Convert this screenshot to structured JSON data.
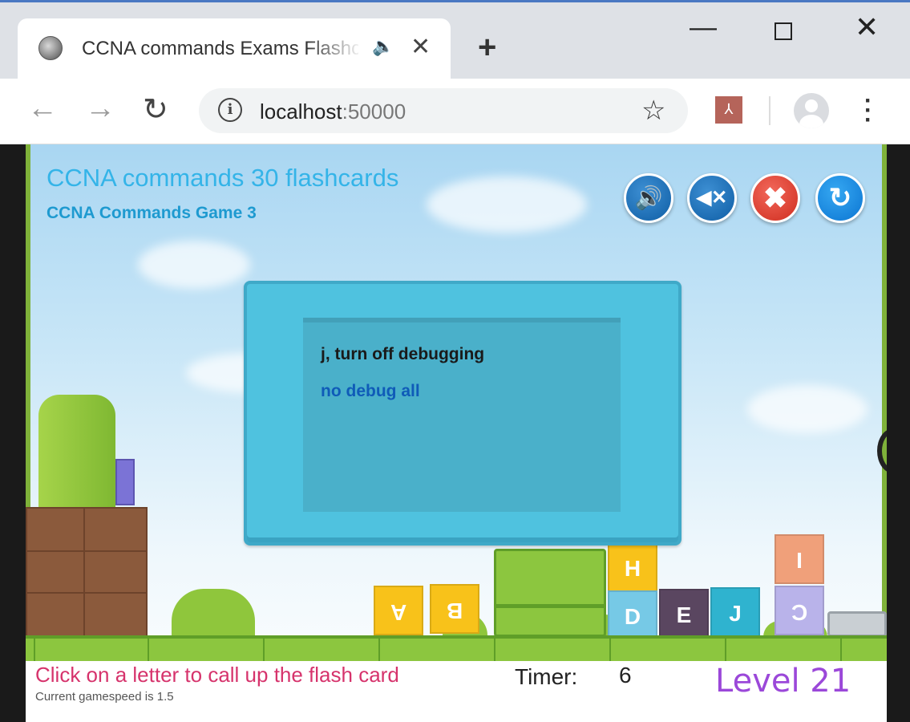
{
  "browser": {
    "tab_title": "CCNA commands Exams Flashcards",
    "tab_audio_icon": "speaker-icon",
    "tab_close_glyph": "✕",
    "new_tab_glyph": "+",
    "url_host": "localhost",
    "url_port": ":50000",
    "window_minimize_glyph": "—",
    "window_close_glyph": "✕"
  },
  "game": {
    "title": "CCNA commands 30 flashcards",
    "subtitle": "CCNA Commands Game 3",
    "buttons": {
      "sound_glyph": "🔊",
      "mute_glyph": "◀✕",
      "close_glyph": "✖",
      "restart_glyph": "↻"
    },
    "flashcard": {
      "question": "j, turn off debugging",
      "answer": "no debug all"
    },
    "letters": [
      {
        "char": "A",
        "color": "#f8c21a"
      },
      {
        "char": "B",
        "color": "#f8c21a"
      },
      {
        "char": "H",
        "color": "#f8c21a"
      },
      {
        "char": "D",
        "color": "#76c9e6"
      },
      {
        "char": "E",
        "color": "#5a4660"
      },
      {
        "char": "J",
        "color": "#2fb3cf"
      },
      {
        "char": "I",
        "color": "#f0a07a"
      },
      {
        "char": "C",
        "color": "#b9b3ea"
      }
    ],
    "status": {
      "message": "Click on a letter to call up the flash card",
      "gamespeed": "Current gamespeed is 1.5",
      "timer_label": "Timer:",
      "timer_value": "6",
      "level": "Level 21"
    }
  }
}
